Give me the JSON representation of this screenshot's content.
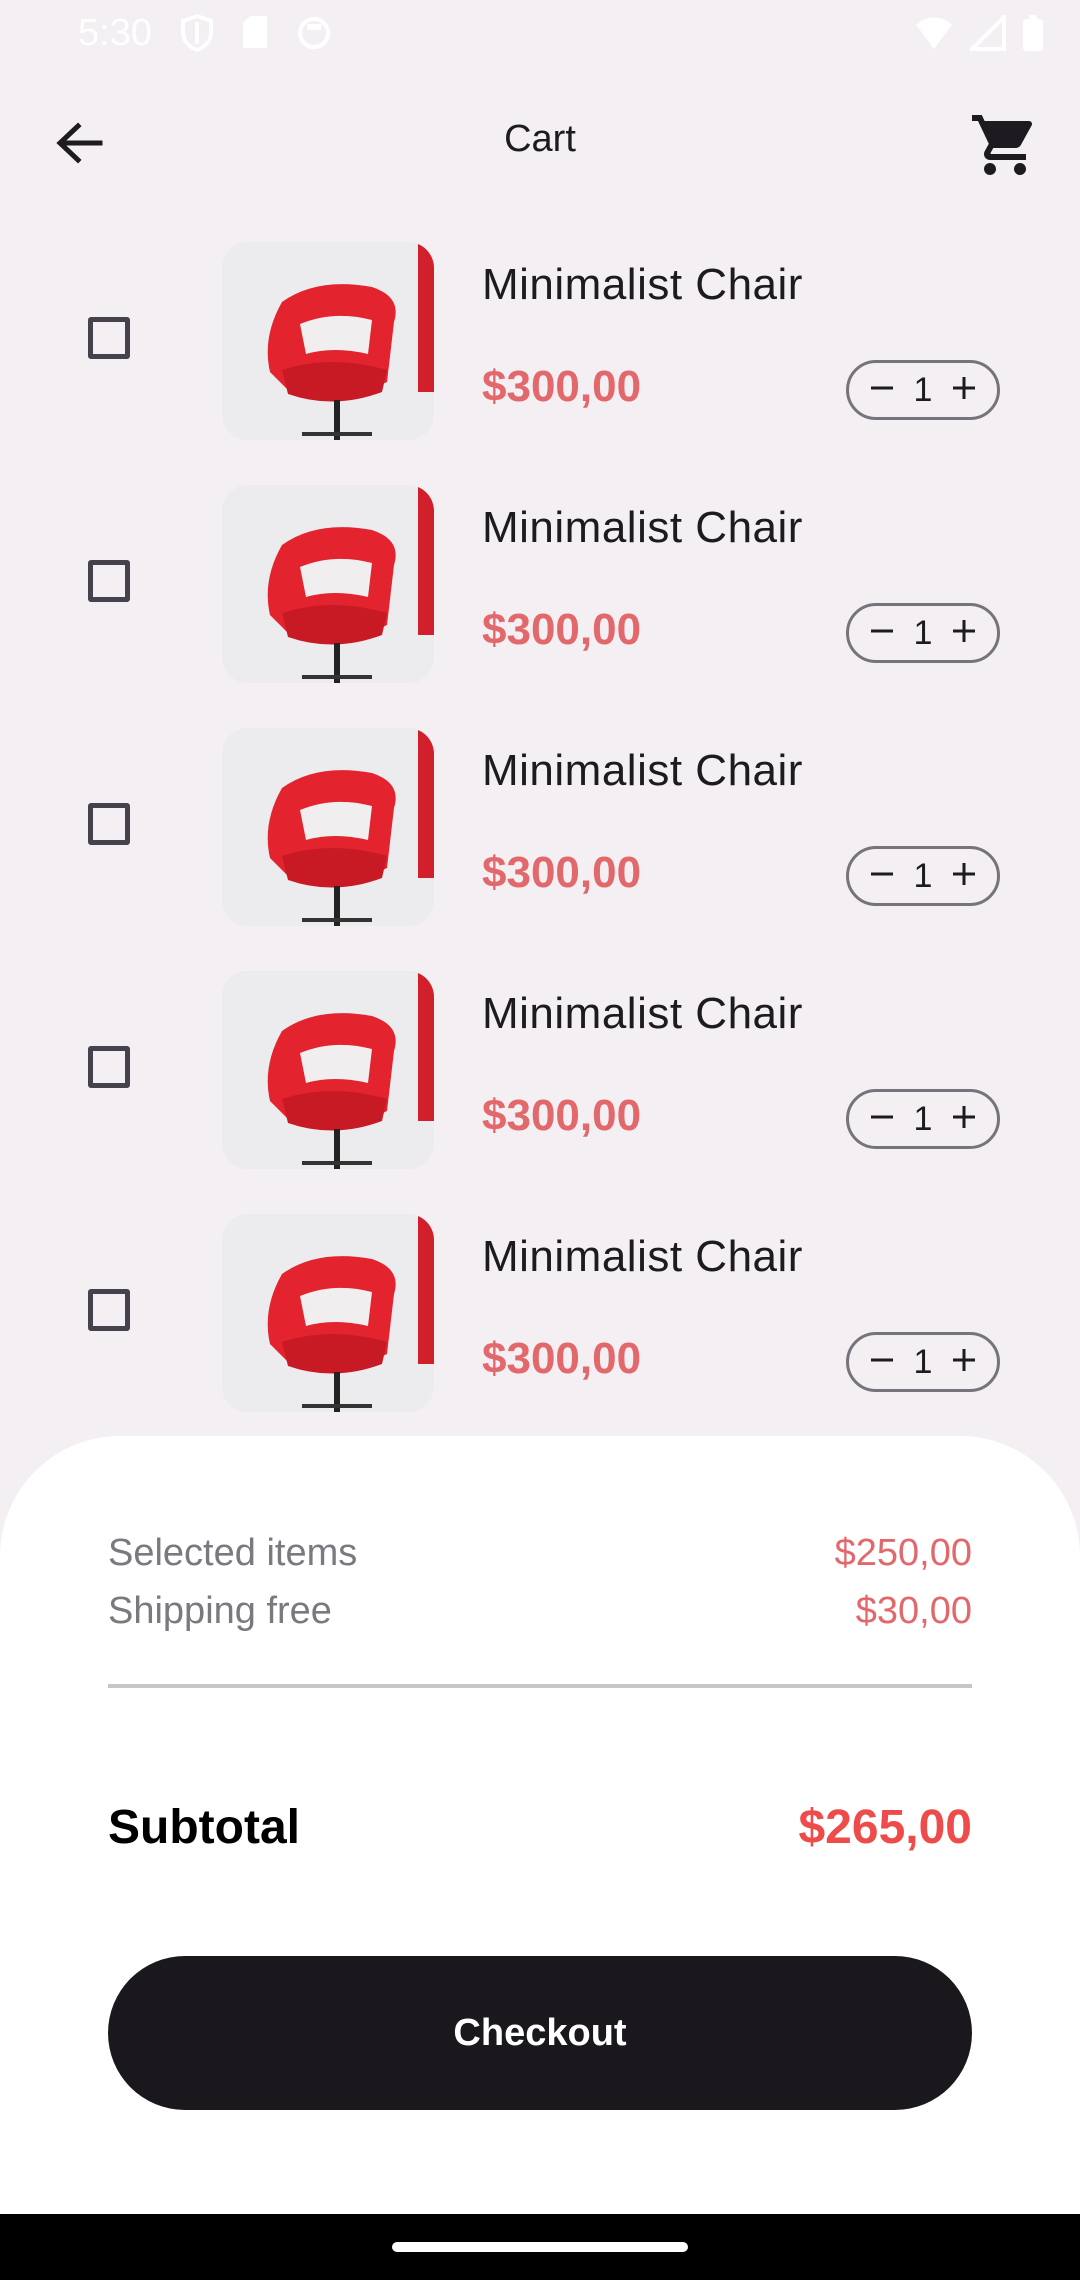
{
  "status_bar": {
    "time": "5:30",
    "left_icons": [
      "shield-icon",
      "sd-card-icon",
      "record-icon"
    ],
    "right_icons": [
      "wifi-icon",
      "signal-icon",
      "battery-icon"
    ]
  },
  "app_bar": {
    "title": "Cart",
    "back_icon": "arrow-back-icon",
    "cart_icon": "shopping-cart-icon"
  },
  "cart": {
    "items": [
      {
        "name": "Minimalist Chair",
        "price": "$300,00",
        "quantity": "1",
        "checked": false
      },
      {
        "name": "Minimalist Chair",
        "price": "$300,00",
        "quantity": "1",
        "checked": false
      },
      {
        "name": "Minimalist Chair",
        "price": "$300,00",
        "quantity": "1",
        "checked": false
      },
      {
        "name": "Minimalist Chair",
        "price": "$300,00",
        "quantity": "1",
        "checked": false
      },
      {
        "name": "Minimalist Chair",
        "price": "$300,00",
        "quantity": "1",
        "checked": false
      }
    ]
  },
  "summary": {
    "selected_label": "Selected items",
    "selected_value": "$250,00",
    "shipping_label": "Shipping free",
    "shipping_value": "$30,00",
    "subtotal_label": "Subtotal",
    "subtotal_value": "$265,00",
    "checkout_label": "Checkout"
  },
  "colors": {
    "background": "#f3eff3",
    "price": "#e2686b",
    "subtotal": "#ee4b4b",
    "button": "#1a181d",
    "chair": "#e3232e"
  }
}
